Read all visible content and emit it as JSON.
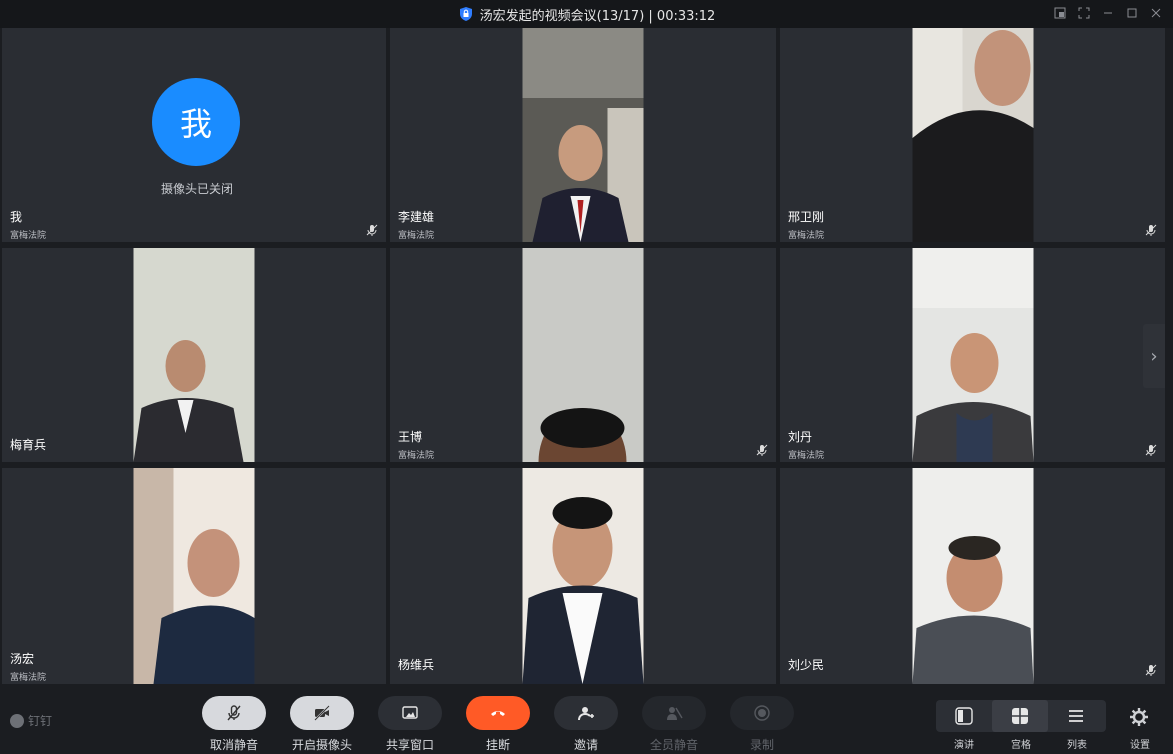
{
  "window": {
    "title": "汤宏发起的视频会议(13/17) | 00:33:12"
  },
  "self_tile": {
    "avatar_char": "我",
    "camera_status": "摄像头已关闭"
  },
  "participants": [
    {
      "name": "我",
      "org": "富梅法院",
      "muted": true,
      "video": false
    },
    {
      "name": "李建雄",
      "org": "富梅法院",
      "muted": false,
      "video": true
    },
    {
      "name": "邢卫刚",
      "org": "富梅法院",
      "muted": true,
      "video": true
    },
    {
      "name": "梅育兵",
      "org": "",
      "muted": false,
      "video": true
    },
    {
      "name": "王博",
      "org": "富梅法院",
      "muted": true,
      "video": true
    },
    {
      "name": "刘丹",
      "org": "富梅法院",
      "muted": true,
      "video": true
    },
    {
      "name": "汤宏",
      "org": "富梅法院",
      "muted": false,
      "video": true
    },
    {
      "name": "杨维兵",
      "org": "",
      "muted": false,
      "video": true
    },
    {
      "name": "刘少民",
      "org": "",
      "muted": true,
      "video": true
    }
  ],
  "controls": {
    "unmute": "取消静音",
    "camera_on": "开启摄像头",
    "share_window": "共享窗口",
    "hang_up": "挂断",
    "invite": "邀请",
    "mute_all": "全员静音",
    "record": "录制"
  },
  "views": {
    "speaker": "演讲",
    "grid": "宫格",
    "list": "列表",
    "active": "grid"
  },
  "settings_label": "设置",
  "app_logo_text": "钉钉",
  "colors": {
    "accent_blue": "#1a8cff",
    "hangup_red": "#ff5a26",
    "tile_bg": "#2a2d33"
  }
}
